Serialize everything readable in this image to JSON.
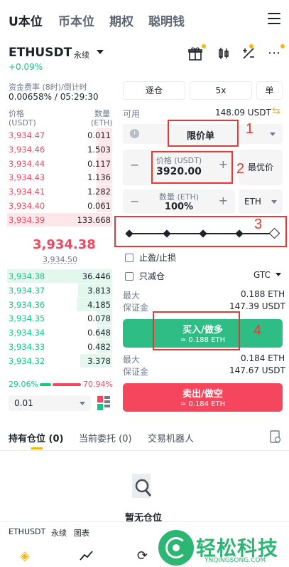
{
  "top_tabs": [
    "U本位",
    "币本位",
    "期权",
    "聪明钱"
  ],
  "header": {
    "symbol": "ETHUSDT",
    "contract_type": "永续",
    "change": "+0.09%"
  },
  "funding": {
    "label": "资金费率 (8时)/倒计时",
    "value": "0.00658% / 05:29:30"
  },
  "orderbook": {
    "col_price": "价格",
    "col_price_unit": "(USDT)",
    "col_qty": "数量",
    "col_qty_unit": "(ETH)",
    "asks": [
      {
        "price": "3,934.47",
        "qty": "0.011"
      },
      {
        "price": "3,934.46",
        "qty": "1.503"
      },
      {
        "price": "3,934.44",
        "qty": "0.117"
      },
      {
        "price": "3,934.43",
        "qty": "1.136"
      },
      {
        "price": "3,934.41",
        "qty": "1.282"
      },
      {
        "price": "3,934.40",
        "qty": "0.061"
      },
      {
        "price": "3,934.39",
        "qty": "133.668"
      }
    ],
    "last_price": "3,934.38",
    "mark_price": "3,934.50",
    "bids": [
      {
        "price": "3,934.38",
        "qty": "36.446"
      },
      {
        "price": "3,934.37",
        "qty": "3.813"
      },
      {
        "price": "3,934.36",
        "qty": "4.185"
      },
      {
        "price": "3,934.35",
        "qty": "0.078"
      },
      {
        "price": "3,934.34",
        "qty": "0.648"
      },
      {
        "price": "3,934.33",
        "qty": "0.482"
      },
      {
        "price": "3,934.32",
        "qty": "3.378"
      }
    ],
    "buy_pct": "29.06%",
    "sell_pct": "70.94%",
    "buy_ratio": 0.2906,
    "precision": "0.01"
  },
  "order_form": {
    "margin_mode": "逐仓",
    "leverage": "5x",
    "position_mode": "单",
    "available_label": "可用",
    "available_value": "148.09 USDT",
    "order_type": "限价单",
    "price_label": "价格 (USDT)",
    "price_value": "3920.00",
    "best_price": "最优价",
    "qty_label": "数量 (ETH)",
    "qty_value": "100%",
    "qty_unit": "ETH",
    "tpsl_label": "止盈/止损",
    "reduce_only_label": "只减仓",
    "tif": "GTC",
    "max_label": "最大",
    "margin_label": "保证金",
    "buy_max": "0.188 ETH",
    "buy_margin": "147.39 USDT",
    "buy_label": "买入/做多",
    "buy_sub": "≈ 0.188 ETH",
    "sell_max": "0.184 ETH",
    "sell_margin": "147.67 USDT",
    "sell_label": "卖出/做空",
    "sell_sub": "≈ 0.184 ETH"
  },
  "annotations": [
    "1",
    "2",
    "3",
    "4"
  ],
  "bottom_tabs": [
    {
      "label": "持有仓位",
      "count": "(0)"
    },
    {
      "label": "当前委托",
      "count": "(0)"
    },
    {
      "label": "交易机器人",
      "count": ""
    }
  ],
  "empty_text": "暂无仓位",
  "footer_bar": {
    "symbol": "ETHUSDT",
    "type": "永续",
    "chart": "图表"
  },
  "watermark": {
    "text": "轻松科技",
    "sub": "YNQINGSONG.COM"
  },
  "colors": {
    "green": "#0ecb81",
    "red": "#f6465d",
    "accent": "#f0b90b",
    "annotation": "#e53935"
  }
}
